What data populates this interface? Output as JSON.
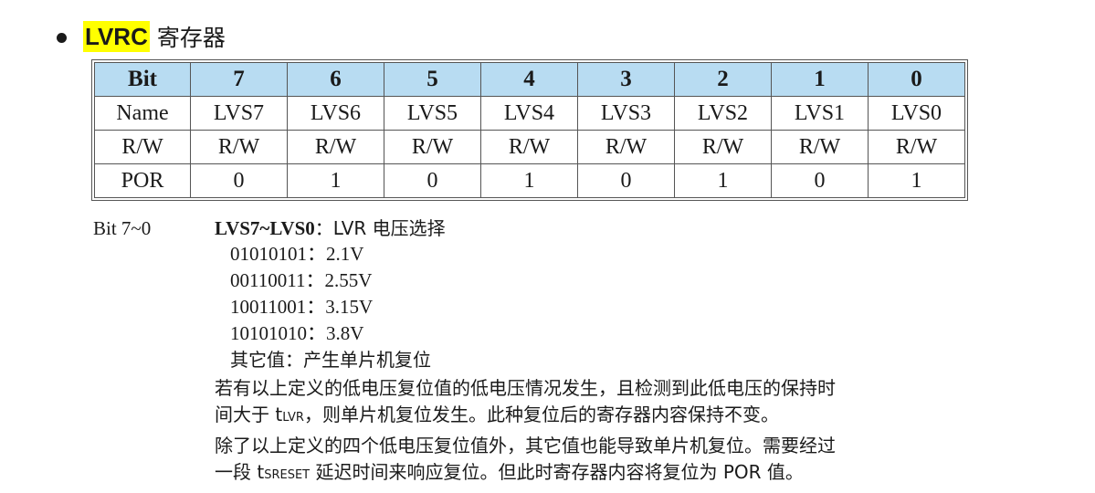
{
  "heading": {
    "register_name": "LVRC",
    "title_suffix": "寄存器"
  },
  "table": {
    "header": [
      "Bit",
      "7",
      "6",
      "5",
      "4",
      "3",
      "2",
      "1",
      "0"
    ],
    "rows": [
      [
        "Name",
        "LVS7",
        "LVS6",
        "LVS5",
        "LVS4",
        "LVS3",
        "LVS2",
        "LVS1",
        "LVS0"
      ],
      [
        "R/W",
        "R/W",
        "R/W",
        "R/W",
        "R/W",
        "R/W",
        "R/W",
        "R/W",
        "R/W"
      ],
      [
        "POR",
        "0",
        "1",
        "0",
        "1",
        "0",
        "1",
        "0",
        "1"
      ]
    ]
  },
  "description": {
    "bit_range": "Bit 7~0",
    "field_name": "LVS7~LVS0",
    "field_title": "：LVR 电压选择",
    "options": [
      {
        "code": "01010101",
        "value": "：2.1V"
      },
      {
        "code": "00110011",
        "value": "：2.55V"
      },
      {
        "code": "10011001",
        "value": "：3.15V"
      },
      {
        "code": "10101010",
        "value": "：3.8V"
      }
    ],
    "other": "其它值：产生单片机复位",
    "p1_line1": "若有以上定义的低电压复位值的低电压情况发生，且检测到此低电压的保持时",
    "p1_line2_a": "间大于 t",
    "p1_line2_sub": "LVR",
    "p1_line2_b": "，则单片机复位发生。此种复位后的寄存器内容保持不变。",
    "p2_line1": "除了以上定义的四个低电压复位值外，其它值也能导致单片机复位。需要经过",
    "p2_line2_a": "一段 t",
    "p2_line2_sub": "SRESET",
    "p2_line2_b": " 延迟时间来响应复位。但此时寄存器内容将复位为 POR 值。"
  },
  "colors": {
    "header_fill": "#b8dcf2",
    "highlight": "#ffff00"
  }
}
